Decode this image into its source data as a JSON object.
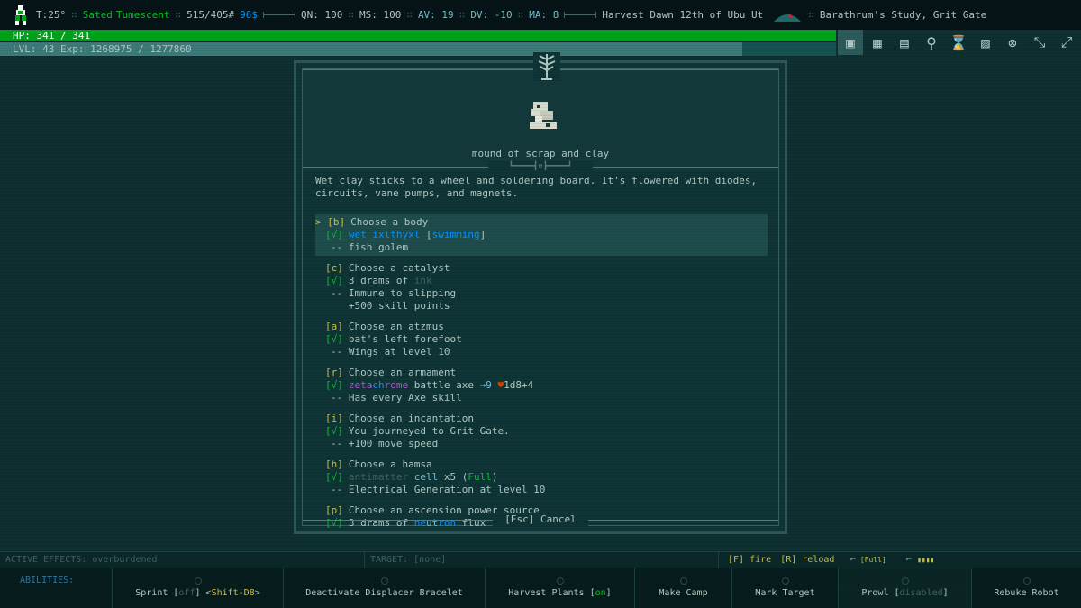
{
  "status": {
    "temperature": "T:25°",
    "hunger": "Sated",
    "state": "Tumescent",
    "weight": "515/405#",
    "money": "96$",
    "qn": "QN: 100",
    "ms": "MS: 100",
    "av": "AV: 19",
    "dv": "DV: -10",
    "ma": "MA: 8",
    "date": "Harvest Dawn 12th of Ubu Ut",
    "location": "Barathrum's Study, Grit Gate"
  },
  "hp": {
    "label": "HP: 341 / 341",
    "fraction": 1.0
  },
  "level": {
    "label": "LVL: 43 Exp: 1268975 / 1277860",
    "fraction": 0.993
  },
  "toolbar": [
    {
      "name": "inventory-icon",
      "glyph": "▣",
      "active": true
    },
    {
      "name": "world-map-icon",
      "glyph": "▦"
    },
    {
      "name": "local-map-icon",
      "glyph": "▤"
    },
    {
      "name": "look-icon",
      "glyph": "⚲"
    },
    {
      "name": "wait-icon",
      "glyph": "⌛"
    },
    {
      "name": "character-icon",
      "glyph": "▨"
    },
    {
      "name": "compass-icon",
      "glyph": "⊗"
    },
    {
      "name": "auto-explore-icon",
      "glyph": "⤡"
    },
    {
      "name": "auto-travel-icon",
      "glyph": "⤢"
    }
  ],
  "dialog": {
    "object_name": "mound of scrap and clay",
    "description": "Wet clay sticks to a wheel and soldering board. It's flowered with diodes, circuits, vane pumps, and magnets.",
    "cancel_label": "[Esc] Cancel",
    "choices": [
      {
        "key": "> [b]",
        "title": "Choose a body",
        "check": "[√]",
        "value_parts": [
          {
            "t": "wet ixlthyxl ",
            "c": "c-blue"
          },
          {
            "t": "[",
            "c": "c-gray"
          },
          {
            "t": "swimming",
            "c": "c-blue"
          },
          {
            "t": "]",
            "c": "c-gray"
          }
        ],
        "effects": [
          "-- fish golem"
        ],
        "selected": true
      },
      {
        "key": "[c]",
        "title": "Choose a catalyst",
        "check": "[√]",
        "value_parts": [
          {
            "t": "3 drams of ",
            "c": "c-gray"
          },
          {
            "t": "ink",
            "c": "c-dim"
          }
        ],
        "effects": [
          "-- Immune to slipping",
          "   +500 skill points"
        ]
      },
      {
        "key": "[a]",
        "title": "Choose an atzmus",
        "check": "[√]",
        "value_parts": [
          {
            "t": "bat's left forefoot",
            "c": "c-gray"
          }
        ],
        "effects": [
          "-- Wings at level 10"
        ]
      },
      {
        "key": "[r]",
        "title": "Choose an armament",
        "check": "[√]",
        "value_parts": [
          {
            "t": "zeta",
            "c": "c-purple"
          },
          {
            "t": "ch",
            "c": "c-blue"
          },
          {
            "t": "rome",
            "c": "c-purple"
          },
          {
            "t": " battle axe ",
            "c": "c-gray"
          },
          {
            "t": "→9 ",
            "c": "c-cyan"
          },
          {
            "t": "♥",
            "c": "c-red"
          },
          {
            "t": "1d8+4",
            "c": "c-gray"
          }
        ],
        "effects": [
          "-- Has every Axe skill"
        ]
      },
      {
        "key": "[i]",
        "title": "Choose an incantation",
        "check": "[√]",
        "value_parts": [
          {
            "t": "You journeyed to Grit Gate.",
            "c": "c-gray"
          }
        ],
        "effects": [
          "-- +100 move speed"
        ]
      },
      {
        "key": "[h]",
        "title": "Choose a hamsa",
        "check": "[√]",
        "value_parts": [
          {
            "t": "antimatter ",
            "c": "c-dim"
          },
          {
            "t": "cell",
            "c": "c-cyan"
          },
          {
            "t": " x5 (",
            "c": "c-gray"
          },
          {
            "t": "Full",
            "c": "c-green"
          },
          {
            "t": ")",
            "c": "c-gray"
          }
        ],
        "effects": [
          "-- Electrical Generation at level 10"
        ]
      },
      {
        "key": "[p]",
        "title": "Choose an ascension power source",
        "check": "[√]",
        "value_parts": [
          {
            "t": "3 drams of ",
            "c": "c-gray"
          },
          {
            "t": "ne",
            "c": "c-blue"
          },
          {
            "t": "ut",
            "c": "c-cyan"
          },
          {
            "t": "ron",
            "c": "c-blue"
          },
          {
            "t": " flux",
            "c": "c-gray"
          }
        ],
        "effects": []
      }
    ]
  },
  "effects_bar": {
    "active_effects": "ACTIVE EFFECTS: overburdened",
    "target": "TARGET: [none]",
    "fire": "[F] fire",
    "reload": "[R] reload",
    "ammo_label": "[Full]"
  },
  "abilities": {
    "label": "ABILITIES:",
    "items": [
      {
        "name": "sprint",
        "parts": [
          {
            "t": "Sprint ",
            "c": "c-gray"
          },
          {
            "t": "[",
            "c": "c-gray"
          },
          {
            "t": "off",
            "c": "c-dim"
          },
          {
            "t": "] ",
            "c": "c-gray"
          },
          {
            "t": "<",
            "c": "c-gray"
          },
          {
            "t": "Shift-D8",
            "c": "c-yellow"
          },
          {
            "t": ">",
            "c": "c-gray"
          }
        ]
      },
      {
        "name": "deactivate-displacer-bracelet",
        "parts": [
          {
            "t": "Deactivate Displacer Bracelet",
            "c": "c-gray"
          }
        ]
      },
      {
        "name": "harvest-plants",
        "parts": [
          {
            "t": "Harvest Plants ",
            "c": "c-gray"
          },
          {
            "t": "[",
            "c": "c-gray"
          },
          {
            "t": "on",
            "c": "c-green"
          },
          {
            "t": "]",
            "c": "c-gray"
          }
        ]
      },
      {
        "name": "make-camp",
        "parts": [
          {
            "t": "Make Camp",
            "c": "c-gray"
          }
        ]
      },
      {
        "name": "mark-target",
        "parts": [
          {
            "t": "Mark Target",
            "c": "c-gray"
          }
        ]
      },
      {
        "name": "prowl",
        "parts": [
          {
            "t": "Prowl ",
            "c": "c-gray"
          },
          {
            "t": "[",
            "c": "c-gray"
          },
          {
            "t": "disabled",
            "c": "c-dim"
          },
          {
            "t": "]",
            "c": "c-gray"
          }
        ],
        "active": true
      },
      {
        "name": "rebuke-robot",
        "parts": [
          {
            "t": "Rebuke Robot",
            "c": "c-gray"
          }
        ]
      }
    ]
  }
}
